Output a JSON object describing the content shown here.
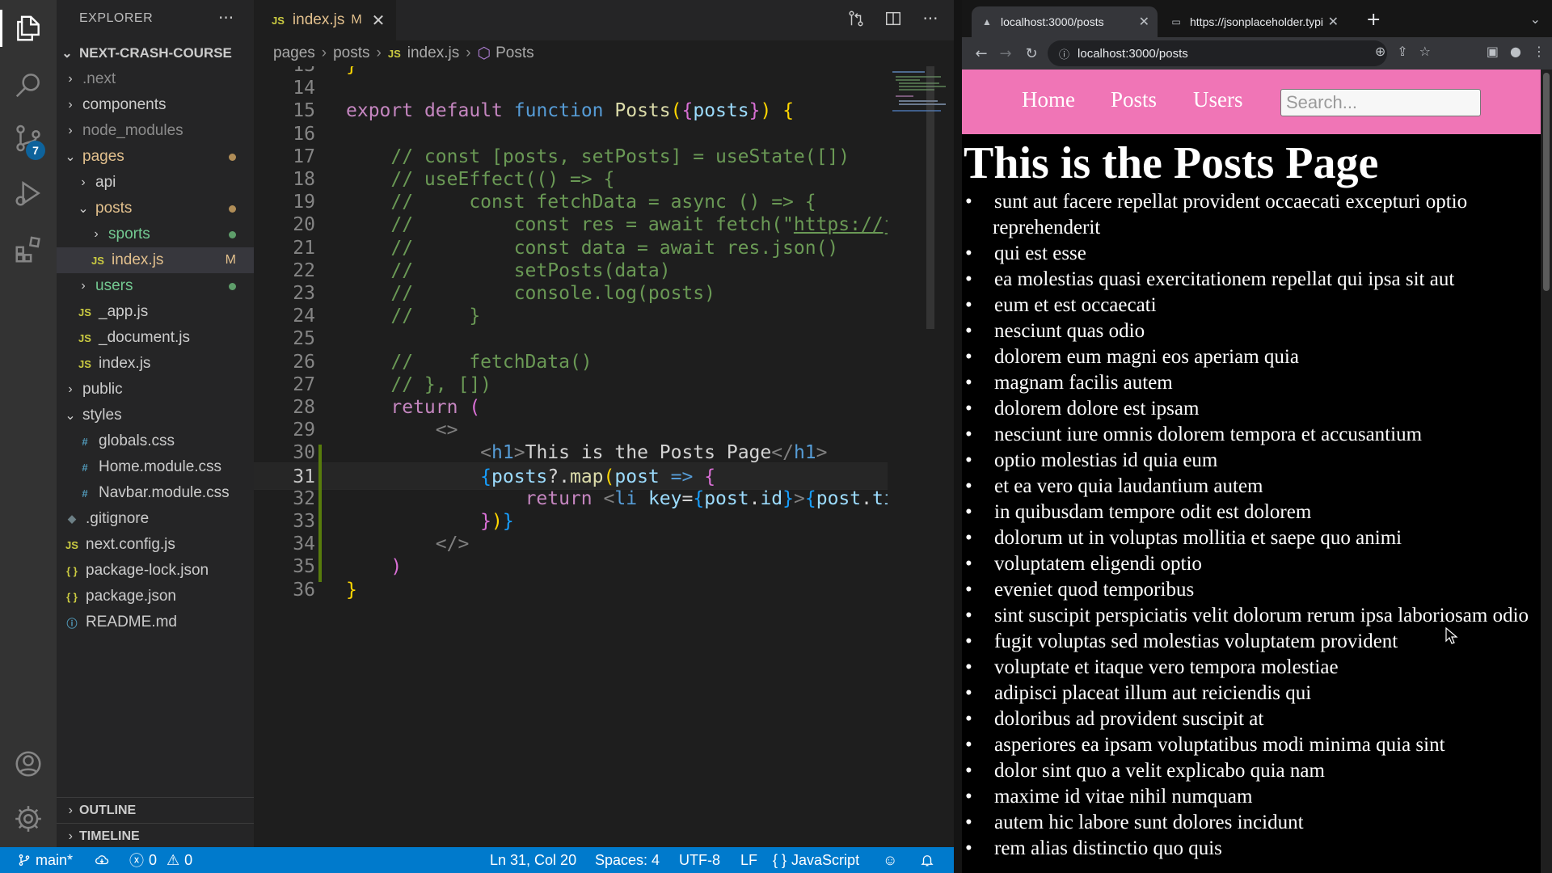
{
  "vscode": {
    "activity_badge": "7",
    "explorer": {
      "title": "EXPLORER",
      "more": "···",
      "root": "NEXT-CRASH-COURSE",
      "items": [
        {
          "label": ".next",
          "type": "folder",
          "open": false,
          "depth": 1,
          "color": "dim"
        },
        {
          "label": "components",
          "type": "folder",
          "open": false,
          "depth": 1
        },
        {
          "label": "node_modules",
          "type": "folder",
          "open": false,
          "depth": 1,
          "color": "dim"
        },
        {
          "label": "pages",
          "type": "folder",
          "open": true,
          "depth": 1,
          "color": "amber",
          "dot": "#b08d57"
        },
        {
          "label": "api",
          "type": "folder",
          "open": false,
          "depth": 2
        },
        {
          "label": "posts",
          "type": "folder",
          "open": true,
          "depth": 2,
          "color": "amber",
          "dot": "#b08d57"
        },
        {
          "label": "sports",
          "type": "folder",
          "open": false,
          "depth": 3,
          "color": "green",
          "dot": "#5e9e6a"
        },
        {
          "label": "index.js",
          "type": "js",
          "depth": 3,
          "color": "amber",
          "badge": "M",
          "selected": true
        },
        {
          "label": "users",
          "type": "folder",
          "open": false,
          "depth": 2,
          "color": "green",
          "dot": "#5e9e6a"
        },
        {
          "label": "_app.js",
          "type": "js",
          "depth": 2
        },
        {
          "label": "_document.js",
          "type": "js",
          "depth": 2
        },
        {
          "label": "index.js",
          "type": "js",
          "depth": 2
        },
        {
          "label": "public",
          "type": "folder",
          "open": false,
          "depth": 1
        },
        {
          "label": "styles",
          "type": "folder",
          "open": true,
          "depth": 1
        },
        {
          "label": "globals.css",
          "type": "css",
          "depth": 2
        },
        {
          "label": "Home.module.css",
          "type": "css",
          "depth": 2
        },
        {
          "label": "Navbar.module.css",
          "type": "css",
          "depth": 2
        },
        {
          "label": ".gitignore",
          "type": "git",
          "depth": 1
        },
        {
          "label": "next.config.js",
          "type": "js",
          "depth": 1
        },
        {
          "label": "package-lock.json",
          "type": "json",
          "depth": 1
        },
        {
          "label": "package.json",
          "type": "json",
          "depth": 1
        },
        {
          "label": "README.md",
          "type": "info",
          "depth": 1
        }
      ],
      "outline": "OUTLINE",
      "timeline": "TIMELINE"
    },
    "tab": {
      "label": "index.js",
      "modified": "M",
      "icon": "JS"
    },
    "breadcrumb": [
      "pages",
      "posts",
      "index.js",
      "Posts"
    ],
    "code_lines": [
      {
        "n": "13",
        "tokens": [
          [
            "p1",
            "}"
          ]
        ]
      },
      {
        "n": "14",
        "tokens": []
      },
      {
        "n": "15",
        "tokens": [
          [
            "kw",
            "export"
          ],
          [
            "tx",
            " "
          ],
          [
            "kw",
            "default"
          ],
          [
            "tx",
            " "
          ],
          [
            "k",
            "function"
          ],
          [
            "tx",
            " "
          ],
          [
            "fn",
            "Posts"
          ],
          [
            "p1",
            "("
          ],
          [
            "p2",
            "{"
          ],
          [
            "v",
            "posts"
          ],
          [
            "p2",
            "}"
          ],
          [
            "p1",
            ")"
          ],
          [
            "tx",
            " "
          ],
          [
            "p1",
            "{"
          ]
        ]
      },
      {
        "n": "16",
        "tokens": []
      },
      {
        "n": "17",
        "tokens": [
          [
            "cm",
            "    // const [posts, setPosts] = useState([])"
          ]
        ]
      },
      {
        "n": "18",
        "tokens": [
          [
            "cm",
            "    // useEffect(() => {"
          ]
        ]
      },
      {
        "n": "19",
        "tokens": [
          [
            "cm",
            "    //     const fetchData = async () => {"
          ]
        ]
      },
      {
        "n": "20",
        "tokens": [
          [
            "cm",
            "    //         const res = await fetch(\""
          ],
          [
            "cmu",
            "https://jsonplaceholder.typicode.com/posts"
          ],
          [
            "cm",
            "\")"
          ]
        ]
      },
      {
        "n": "21",
        "tokens": [
          [
            "cm",
            "    //         const data = await res.json()"
          ]
        ]
      },
      {
        "n": "22",
        "tokens": [
          [
            "cm",
            "    //         setPosts(data)"
          ]
        ]
      },
      {
        "n": "23",
        "tokens": [
          [
            "cm",
            "    //         console.log(posts)"
          ]
        ]
      },
      {
        "n": "24",
        "tokens": [
          [
            "cm",
            "    //     }"
          ]
        ]
      },
      {
        "n": "25",
        "tokens": []
      },
      {
        "n": "26",
        "tokens": [
          [
            "cm",
            "    //     fetchData()"
          ]
        ]
      },
      {
        "n": "27",
        "tokens": [
          [
            "cm",
            "    // }, [])"
          ]
        ]
      },
      {
        "n": "28",
        "tokens": [
          [
            "tx",
            "    "
          ],
          [
            "kw",
            "return"
          ],
          [
            "tx",
            " "
          ],
          [
            "p2",
            "("
          ]
        ]
      },
      {
        "n": "29",
        "tokens": [
          [
            "tx",
            "        "
          ],
          [
            "tg",
            "<>"
          ]
        ]
      },
      {
        "n": "30",
        "tokens": [
          [
            "tx",
            "            "
          ],
          [
            "tg",
            "<"
          ],
          [
            "tn",
            "h1"
          ],
          [
            "tg",
            ">"
          ],
          [
            "tx",
            "This is the Posts Page"
          ],
          [
            "tg",
            "</"
          ],
          [
            "tn",
            "h1"
          ],
          [
            "tg",
            ">"
          ]
        ]
      },
      {
        "n": "31",
        "tokens": [
          [
            "tx",
            "            "
          ],
          [
            "p3",
            "{"
          ],
          [
            "v",
            "posts"
          ],
          [
            "tx",
            "?."
          ],
          [
            "fn",
            "map"
          ],
          [
            "p1",
            "("
          ],
          [
            "v",
            "post"
          ],
          [
            "tx",
            " "
          ],
          [
            "k",
            "=>"
          ],
          [
            "tx",
            " "
          ],
          [
            "p2",
            "{"
          ]
        ],
        "current": true
      },
      {
        "n": "32",
        "tokens": [
          [
            "tx",
            "                "
          ],
          [
            "kw",
            "return"
          ],
          [
            "tx",
            " "
          ],
          [
            "tg",
            "<"
          ],
          [
            "tn",
            "li"
          ],
          [
            "tx",
            " "
          ],
          [
            "v",
            "key"
          ],
          [
            "tx",
            "="
          ],
          [
            "p3",
            "{"
          ],
          [
            "v",
            "post"
          ],
          [
            "tx",
            "."
          ],
          [
            "v",
            "id"
          ],
          [
            "p3",
            "}"
          ],
          [
            "tg",
            ">"
          ],
          [
            "p3",
            "{"
          ],
          [
            "v",
            "post"
          ],
          [
            "tx",
            "."
          ],
          [
            "v",
            "title"
          ],
          [
            "p3",
            "}"
          ],
          [
            "tg",
            "</"
          ],
          [
            "tn",
            "li"
          ],
          [
            "tg",
            ">"
          ]
        ]
      },
      {
        "n": "33",
        "tokens": [
          [
            "tx",
            "            "
          ],
          [
            "p2",
            "}"
          ],
          [
            "p1",
            ")"
          ],
          [
            "p3",
            "}"
          ]
        ]
      },
      {
        "n": "34",
        "tokens": [
          [
            "tx",
            "        "
          ],
          [
            "tg",
            "</>"
          ]
        ]
      },
      {
        "n": "35",
        "tokens": [
          [
            "tx",
            "    "
          ],
          [
            "p2",
            ")"
          ]
        ]
      },
      {
        "n": "36",
        "tokens": [
          [
            "p1",
            "}"
          ]
        ]
      }
    ],
    "status": {
      "branch": "main*",
      "errors": "0",
      "warnings": "0",
      "position": "Ln 31, Col 20",
      "spaces": "Spaces: 4",
      "encoding": "UTF-8",
      "eol": "LF",
      "language": "JavaScript"
    }
  },
  "browser": {
    "tabs": [
      {
        "title": "localhost:3000/posts",
        "active": true
      },
      {
        "title": "https://jsonplaceholder.typicode.com/posts",
        "active": false
      }
    ],
    "url": "localhost:3000/posts",
    "page": {
      "nav_links": [
        "Home",
        "Posts",
        "Users"
      ],
      "search_placeholder": "Search...",
      "heading": "This is the Posts Page",
      "posts": [
        "sunt aut facere repellat provident occaecati excepturi optio reprehenderit",
        "qui est esse",
        "ea molestias quasi exercitationem repellat qui ipsa sit aut",
        "eum et est occaecati",
        "nesciunt quas odio",
        "dolorem eum magni eos aperiam quia",
        "magnam facilis autem",
        "dolorem dolore est ipsam",
        "nesciunt iure omnis dolorem tempora et accusantium",
        "optio molestias id quia eum",
        "et ea vero quia laudantium autem",
        "in quibusdam tempore odit est dolorem",
        "dolorum ut in voluptas mollitia et saepe quo animi",
        "voluptatem eligendi optio",
        "eveniet quod temporibus",
        "sint suscipit perspiciatis velit dolorum rerum ipsa laboriosam odio",
        "fugit voluptas sed molestias voluptatem provident",
        "voluptate et itaque vero tempora molestiae",
        "adipisci placeat illum aut reiciendis qui",
        "doloribus ad provident suscipit at",
        "asperiores ea ipsam voluptatibus modi minima quia sint",
        "dolor sint quo a velit explicabo quia nam",
        "maxime id vitae nihil numquam",
        "autem hic labore sunt dolores incidunt",
        "rem alias distinctio quo quis"
      ]
    }
  },
  "colors": {
    "vscode_bg": "#1e1e1e",
    "statusbar": "#007acc",
    "navbar_pink": "#f075b6",
    "modified": "#e2c08d",
    "untracked": "#73c991"
  }
}
